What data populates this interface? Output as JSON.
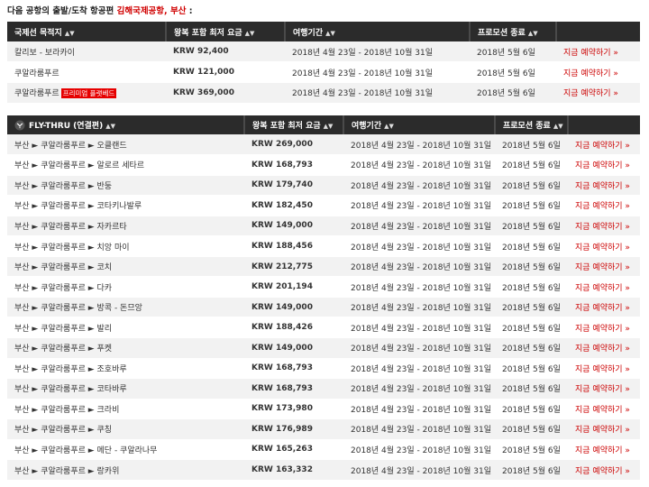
{
  "heading": {
    "prefix": "다음 공항의 출발/도착 항공편 ",
    "airport": "김해국제공항, 부산",
    "suffix": " :"
  },
  "intl_table": {
    "headers": [
      "국제선 목적지",
      "왕복 포함 최저 요금",
      "여행기간",
      "프로모션 종료"
    ],
    "rows": [
      {
        "destination": "칼리보 - 보라카이",
        "badge": "",
        "price": "KRW 92,400",
        "period": "2018년 4월 23일 - 2018년 10월 31일",
        "end": "2018년 5월 6일",
        "cta": "지금 예약하기 »"
      },
      {
        "destination": "쿠알라룸푸르",
        "badge": "",
        "price": "KRW 121,000",
        "period": "2018년 4월 23일 - 2018년 10월 31일",
        "end": "2018년 5월 6일",
        "cta": "지금 예약하기 »"
      },
      {
        "destination": "쿠알라룸푸르",
        "badge": "프리미엄 플랫베드",
        "price": "KRW 369,000",
        "period": "2018년 4월 23일 - 2018년 10월 31일",
        "end": "2018년 5월 6일",
        "cta": "지금 예약하기 »"
      }
    ]
  },
  "flythru_table": {
    "headers": [
      "FLY-THRU (연결편)",
      "왕복 포함 최저 요금",
      "여행기간",
      "프로모션 종료"
    ],
    "rows": [
      {
        "route": "부산 ► 쿠알라룸푸르 ► 오클랜드",
        "price": "KRW 269,000",
        "period": "2018년 4월 23일 - 2018년 10월 31일",
        "end": "2018년 5월 6일",
        "cta": "지금 예약하기 »"
      },
      {
        "route": "부산 ► 쿠알라룸푸르 ► 알로르 세타르",
        "price": "KRW 168,793",
        "period": "2018년 4월 23일 - 2018년 10월 31일",
        "end": "2018년 5월 6일",
        "cta": "지금 예약하기 »"
      },
      {
        "route": "부산 ► 쿠알라룸푸르 ► 반둥",
        "price": "KRW 179,740",
        "period": "2018년 4월 23일 - 2018년 10월 31일",
        "end": "2018년 5월 6일",
        "cta": "지금 예약하기 »"
      },
      {
        "route": "부산 ► 쿠알라룸푸르 ► 코타키나발루",
        "price": "KRW 182,450",
        "period": "2018년 4월 23일 - 2018년 10월 31일",
        "end": "2018년 5월 6일",
        "cta": "지금 예약하기 »"
      },
      {
        "route": "부산 ► 쿠알라룸푸르 ► 자카르타",
        "price": "KRW 149,000",
        "period": "2018년 4월 23일 - 2018년 10월 31일",
        "end": "2018년 5월 6일",
        "cta": "지금 예약하기 »"
      },
      {
        "route": "부산 ► 쿠알라룸푸르 ► 치앙 마이",
        "price": "KRW 188,456",
        "period": "2018년 4월 23일 - 2018년 10월 31일",
        "end": "2018년 5월 6일",
        "cta": "지금 예약하기 »"
      },
      {
        "route": "부산 ► 쿠알라룸푸르 ► 코치",
        "price": "KRW 212,775",
        "period": "2018년 4월 23일 - 2018년 10월 31일",
        "end": "2018년 5월 6일",
        "cta": "지금 예약하기 »"
      },
      {
        "route": "부산 ► 쿠알라룸푸르 ► 다카",
        "price": "KRW 201,194",
        "period": "2018년 4월 23일 - 2018년 10월 31일",
        "end": "2018년 5월 6일",
        "cta": "지금 예약하기 »"
      },
      {
        "route": "부산 ► 쿠알라룸푸르 ► 방콕 - 돈므앙",
        "price": "KRW 149,000",
        "period": "2018년 4월 23일 - 2018년 10월 31일",
        "end": "2018년 5월 6일",
        "cta": "지금 예약하기 »"
      },
      {
        "route": "부산 ► 쿠알라룸푸르 ► 발리",
        "price": "KRW 188,426",
        "period": "2018년 4월 23일 - 2018년 10월 31일",
        "end": "2018년 5월 6일",
        "cta": "지금 예약하기 »"
      },
      {
        "route": "부산 ► 쿠알라룸푸르 ► 푸켓",
        "price": "KRW 149,000",
        "period": "2018년 4월 23일 - 2018년 10월 31일",
        "end": "2018년 5월 6일",
        "cta": "지금 예약하기 »"
      },
      {
        "route": "부산 ► 쿠알라룸푸르 ► 조호바루",
        "price": "KRW 168,793",
        "period": "2018년 4월 23일 - 2018년 10월 31일",
        "end": "2018년 5월 6일",
        "cta": "지금 예약하기 »"
      },
      {
        "route": "부산 ► 쿠알라룸푸르 ► 코타바루",
        "price": "KRW 168,793",
        "period": "2018년 4월 23일 - 2018년 10월 31일",
        "end": "2018년 5월 6일",
        "cta": "지금 예약하기 »"
      },
      {
        "route": "부산 ► 쿠알라룸푸르 ► 크라비",
        "price": "KRW 173,980",
        "period": "2018년 4월 23일 - 2018년 10월 31일",
        "end": "2018년 5월 6일",
        "cta": "지금 예약하기 »"
      },
      {
        "route": "부산 ► 쿠알라룸푸르 ► 쿠칭",
        "price": "KRW 176,989",
        "period": "2018년 4월 23일 - 2018년 10월 31일",
        "end": "2018년 5월 6일",
        "cta": "지금 예약하기 »"
      },
      {
        "route": "부산 ► 쿠알라룸푸르 ► 메단 - 쿠알라나무",
        "price": "KRW 165,263",
        "period": "2018년 4월 23일 - 2018년 10월 31일",
        "end": "2018년 5월 6일",
        "cta": "지금 예약하기 »"
      },
      {
        "route": "부산 ► 쿠알라룸푸르 ► 랑카위",
        "price": "KRW 163,332",
        "period": "2018년 4월 23일 - 2018년 10월 31일",
        "end": "2018년 5월 6일",
        "cta": "지금 예약하기 »"
      }
    ]
  },
  "icons": {
    "sort": "sort-arrows-icon",
    "fly_thru": "fly-thru-logo-icon"
  },
  "colors": {
    "header_bg": "#2b2b2b",
    "accent_red": "#cc0000",
    "badge_red": "#e60000",
    "row_alt": "#f2f2f2"
  }
}
